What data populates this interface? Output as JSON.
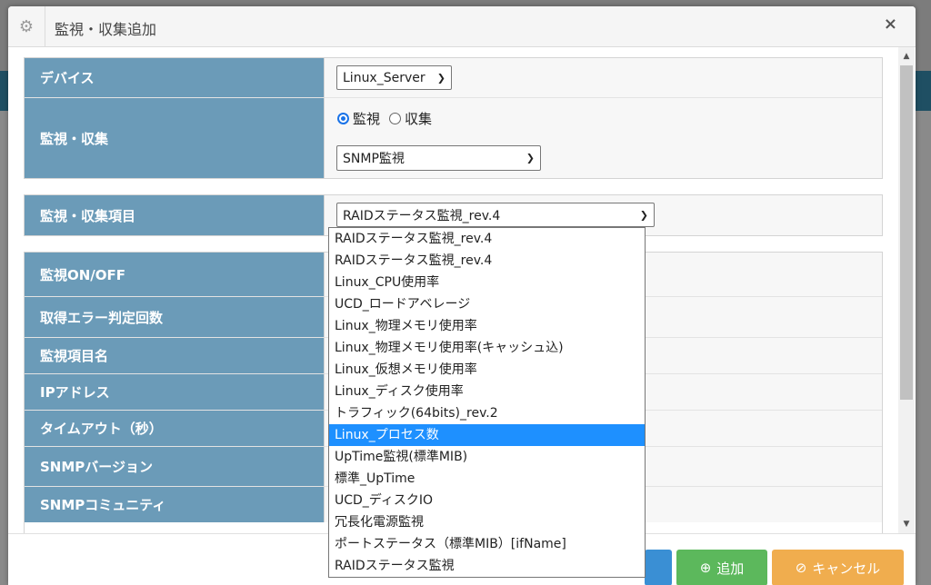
{
  "dialog": {
    "title": "監視・収集追加",
    "settings_icon": "gear-icon",
    "close_label": "×"
  },
  "fields": {
    "device": {
      "label": "デバイス",
      "value": "Linux_Server"
    },
    "mode": {
      "label": "監視・収集",
      "options": [
        "監視",
        "収集"
      ],
      "selected": "監視",
      "type_value": "SNMP監視"
    },
    "item": {
      "label": "監視・収集項目",
      "value": "RAIDステータス監視_rev.4"
    },
    "details": [
      {
        "label": "監視ON/OFF"
      },
      {
        "label": "取得エラー判定回数"
      },
      {
        "label": "監視項目名"
      },
      {
        "label": "IPアドレス"
      },
      {
        "label": "タイムアウト（秒）"
      },
      {
        "label": "SNMPバージョン"
      },
      {
        "label": "SNMPコミュニティ"
      }
    ]
  },
  "dropdown": {
    "options": [
      "RAIDステータス監視_rev.4",
      "RAIDステータス監視_rev.4",
      "Linux_CPU使用率",
      "UCD_ロードアベレージ",
      "Linux_物理メモリ使用率",
      "Linux_物理メモリ使用率(キャッシュ込)",
      "Linux_仮想メモリ使用率",
      "Linux_ディスク使用率",
      "トラフィック(64bits)_rev.2",
      "Linux_プロセス数",
      "UpTime監視(標準MIB)",
      "標準_UpTime",
      "UCD_ディスクIO",
      "冗長化電源監視",
      "ポートステータス（標準MIB）[ifName]",
      "RAIDステータス監視"
    ],
    "highlighted_index": 9
  },
  "footer": {
    "add_label": "追加",
    "cancel_label": "キャンセル"
  },
  "colors": {
    "label_bg": "#6b9bb8",
    "highlight": "#1e90ff",
    "add_button": "#5cb85c",
    "cancel_button": "#f0ad4e"
  }
}
